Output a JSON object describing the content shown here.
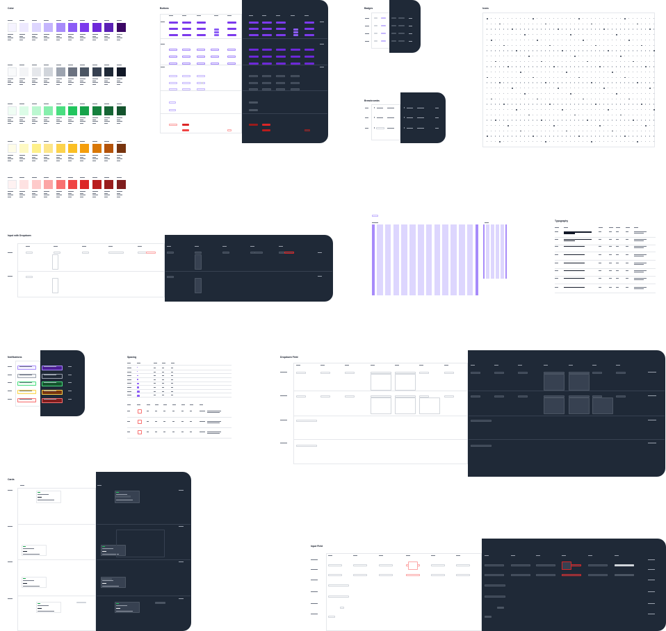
{
  "sections": {
    "colors": "Color",
    "buttons": "Buttons",
    "badges": "Badges",
    "icons": "Icons",
    "breadcrumbs": "Breadcrumbs",
    "input_dropdown": "Input with Dropdown",
    "typography": "Typography",
    "notifications": "Notifications",
    "spacing": "Spacing",
    "dropdown_field": "Dropdown Field",
    "cards": "Cards",
    "input_field": "Input Field"
  },
  "palette": {
    "primary": [
      "#f5f3ff",
      "#ede9fe",
      "#ddd6fe",
      "#c4b5fd",
      "#a78bfa",
      "#8b5cf6",
      "#7c3aed",
      "#6d28d9",
      "#5b21b6",
      "#3b0764"
    ],
    "gray": [
      "#f9fafb",
      "#f3f4f6",
      "#e5e7eb",
      "#d1d5db",
      "#9ca3af",
      "#6b7280",
      "#4b5563",
      "#374151",
      "#1f2937",
      "#111827"
    ],
    "green": [
      "#f0fdf4",
      "#dcfce7",
      "#bbf7d0",
      "#86efac",
      "#4ade80",
      "#22c55e",
      "#16a34a",
      "#15803d",
      "#166534",
      "#14532d"
    ],
    "yellow": [
      "#fefce8",
      "#fef9c3",
      "#fef08a",
      "#fde68a",
      "#fcd34d",
      "#fbbf24",
      "#f59e0b",
      "#d97706",
      "#b45309",
      "#78350f"
    ],
    "red": [
      "#fef2f2",
      "#fee2e2",
      "#fecaca",
      "#fca5a5",
      "#f87171",
      "#ef4444",
      "#dc2626",
      "#b91c1c",
      "#991b1b",
      "#7f1d1d"
    ]
  },
  "colors": {
    "dark_bg": "#1f2937",
    "accent": "#7c3aed",
    "danger": "#dc2626",
    "success": "#16a34a",
    "warning": "#d97706",
    "border": "#e5e7eb"
  }
}
